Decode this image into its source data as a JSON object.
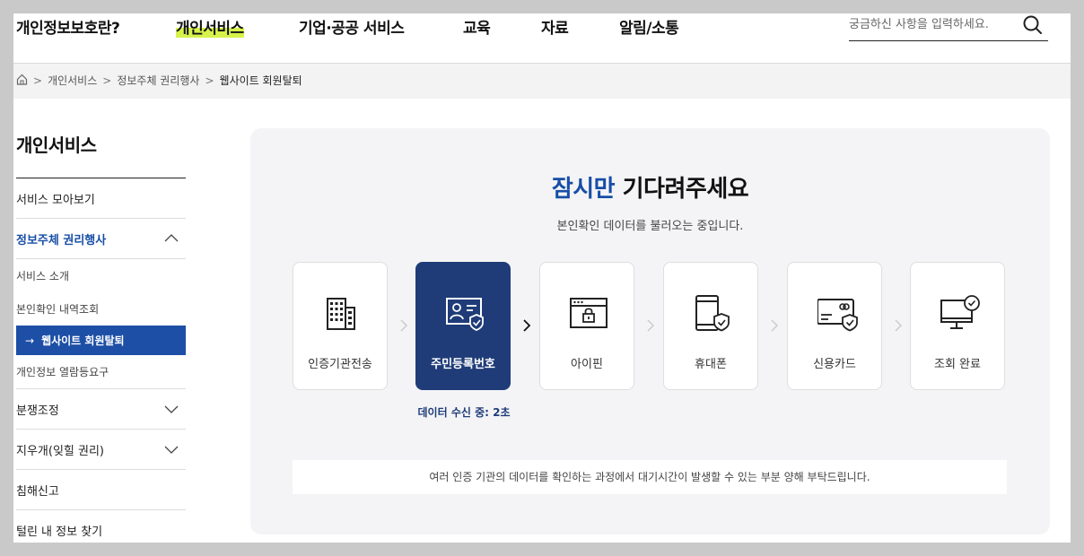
{
  "header": {
    "nav": [
      "개인정보보호란?",
      "개인서비스",
      "기업·공공 서비스",
      "교육",
      "자료",
      "알림/소통"
    ],
    "search_placeholder": "궁금하신 사항을 입력하세요."
  },
  "breadcrumb": [
    "개인서비스",
    "정보주체 권리행사",
    "웹사이트 회원탈퇴"
  ],
  "sidebar": {
    "title": "개인서비스",
    "items": {
      "overview": "서비스 모아보기",
      "rights": "정보주체 권리행사",
      "dispute": "분쟁조정",
      "erasure": "지우개(잊힐 권리)",
      "report": "침해신고",
      "leak": "털린 내 정보 찾기"
    },
    "sub": [
      "서비스 소개",
      "본인확인 내역조회",
      "웹사이트 회원탈퇴",
      "개인정보 열람등요구"
    ],
    "sub_arrow": "→"
  },
  "main": {
    "title_highlight": "잠시만",
    "title_rest": "기다려주세요",
    "subtitle": "본인확인 데이터를 불러오는 중입니다.",
    "steps": [
      "인증기관전송",
      "주민등록번호",
      "아이핀",
      "휴대폰",
      "신용카드",
      "조회 완료"
    ],
    "active_step": 1,
    "status": "데이터 수신 중: 2초",
    "notice": "여러 인증 기관의 데이터를 확인하는 과정에서 대기시간이 발생할 수 있는 부분 양해 부탁드립니다."
  },
  "colors": {
    "accent": "#174ea6",
    "active_step": "#1f3c78",
    "highlight": "#d7f24a"
  }
}
